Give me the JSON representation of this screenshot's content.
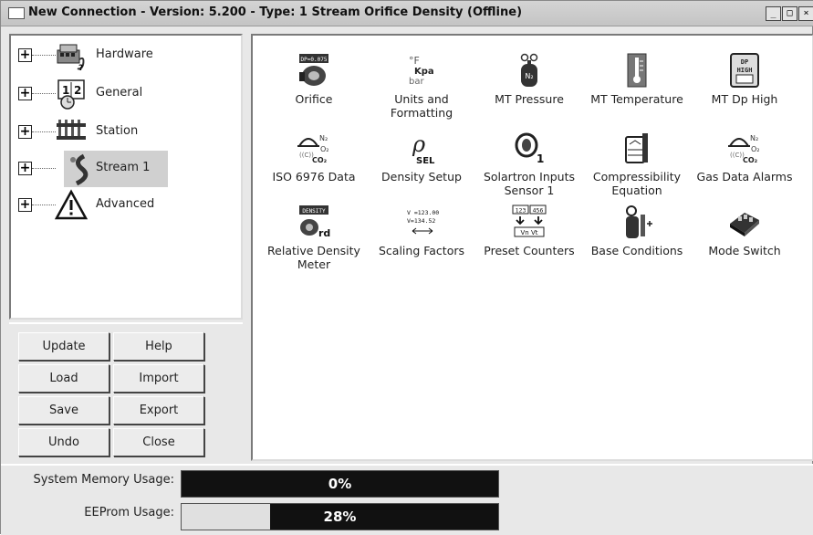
{
  "window": {
    "title": "New Connection - Version: 5.200 - Type: 1 Stream Orifice Density (Offline)",
    "controls": {
      "minimize": "_",
      "maximize": "□",
      "close": "×"
    }
  },
  "tree": {
    "items": [
      {
        "label": "Hardware",
        "icon": "hardware-icon",
        "expander": "+"
      },
      {
        "label": "General",
        "icon": "general-icon",
        "expander": "+"
      },
      {
        "label": "Station",
        "icon": "station-icon",
        "expander": "+"
      },
      {
        "label": "Stream 1",
        "icon": "stream-icon",
        "expander": "+",
        "selected": true
      },
      {
        "label": "Advanced",
        "icon": "warning-icon",
        "expander": "+"
      }
    ]
  },
  "buttons": {
    "update": "Update",
    "help": "Help",
    "load": "Load",
    "import": "Import",
    "save": "Save",
    "export": "Export",
    "undo": "Undo",
    "close": "Close"
  },
  "icons": [
    {
      "label": "Orifice",
      "icon": "orifice-icon",
      "icon_text": "DP=0.075"
    },
    {
      "label": "Units and Formatting",
      "icon": "units-icon",
      "icon_text": "°F Kpa bar"
    },
    {
      "label": "MT Pressure",
      "icon": "pressure-sensor-icon",
      "icon_text": "N₂"
    },
    {
      "label": "MT Temperature",
      "icon": "thermometer-icon",
      "icon_text": ""
    },
    {
      "label": "MT Dp High",
      "icon": "dp-high-icon",
      "icon_text": "DP HIGH"
    },
    {
      "label": "ISO 6976 Data",
      "icon": "gas-composition-icon",
      "icon_text": "N₂ O₂ CO₂"
    },
    {
      "label": "Density Setup",
      "icon": "density-select-icon",
      "icon_text": "SEL"
    },
    {
      "label": "Solartron Inputs Sensor 1",
      "icon": "sensor-icon",
      "icon_text": "1"
    },
    {
      "label": "Compressibility Equation",
      "icon": "compressibility-icon",
      "icon_text": ""
    },
    {
      "label": "Gas Data Alarms",
      "icon": "gas-alarm-icon",
      "icon_text": "N₂ O₂ CO₂"
    },
    {
      "label": "Relative Density Meter",
      "icon": "density-meter-icon",
      "icon_text": "DENSITY rd"
    },
    {
      "label": "Scaling Factors",
      "icon": "scaling-icon",
      "icon_text": "V=123.00 V=134.52"
    },
    {
      "label": "Preset Counters",
      "icon": "counter-icon",
      "icon_text": "123 456"
    },
    {
      "label": "Base Conditions",
      "icon": "base-conditions-icon",
      "icon_text": ""
    },
    {
      "label": "Mode Switch",
      "icon": "switch-icon",
      "icon_text": ""
    }
  ],
  "memory": {
    "system": {
      "label": "System Memory Usage:",
      "value": "0%",
      "fraction": 0.0
    },
    "eeprom": {
      "label": "EEProm Usage:",
      "value": "28%",
      "fraction": 0.28
    }
  }
}
